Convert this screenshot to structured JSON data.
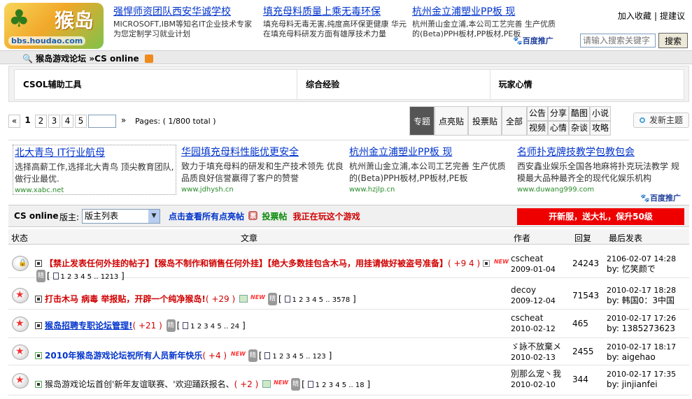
{
  "header": {
    "logo_text": "猴岛",
    "logo_url": "bbs.houdao.com",
    "ads": [
      {
        "title": "强悍师资团队西安华诚学校",
        "desc": "MICROSOFT,IBM等知名IT企业技术专家 为您定制学习就业计划"
      },
      {
        "title": "填充母料质量上乘无毒环保",
        "desc": "填充母料无毒无害,纯度高环保更健康 华元在填充母料研发方面有雄厚技术力量"
      },
      {
        "title": "杭州金立浦塑业PP板 现",
        "desc": "杭州萧山金立浦,本公司工艺完善 生产优质的(Beta)PPH板材,PP板材,PE板"
      }
    ],
    "links": [
      "加入收藏",
      "提建议"
    ],
    "baidu_label": "百度推广",
    "search_placeholder": "请输入搜索关键字",
    "search_button": "搜索"
  },
  "breadcrumb": {
    "forum": "猴岛游戏论坛",
    "sep": "»",
    "current": "CS online"
  },
  "subforums": [
    "CSOL辅助工具",
    "综合经验",
    "玩家心情"
  ],
  "pager": {
    "first": "«",
    "pages": [
      "1",
      "2",
      "3",
      "4",
      "5"
    ],
    "current": "1",
    "last": "»",
    "total": "Pages: ( 1/800 total )"
  },
  "type_filter": {
    "big": [
      "专题",
      "点亮贴",
      "投票贴",
      "全部"
    ],
    "selected": "专题",
    "small": [
      "公告",
      "分享",
      "酷图",
      "小说",
      "视频",
      "心情",
      "杂谈",
      "攻略"
    ]
  },
  "new_thread": "发新主题",
  "ads2": [
    {
      "title": "北大青鸟 IT行业航母",
      "desc": "选择高薪工作,选择北大青鸟 顶尖教育团队,做行业最优.",
      "url": "www.xabc.net"
    },
    {
      "title": "华园填充母料性能优更安全",
      "desc": "致力于填充母料的研发和生产技术领先 优良品质良好信誉赢得了客户的赞誉",
      "url": "www.jdhysh.cn"
    },
    {
      "title": "杭州金立浦塑业PP板 现",
      "desc": "杭州萧山金立浦,本公司工艺完善 生产优质的(Beta)PPH板材,PP板材,PE板",
      "url": "www.hzjlp.cn"
    },
    {
      "title": "名师扑克牌技教学包教包会",
      "desc": "西安鑫业娱乐全国各地麻将扑克玩法教学 规模最大品种最齐全的现代化娱乐机构",
      "url": "www.duwang999.com"
    }
  ],
  "forum_bar": {
    "name": "CS online",
    "moderator_label": "版主:",
    "moderator_select": "版主列表",
    "link1": "点击查看所有点亮帖",
    "link2": "投票帖",
    "link3": "我正在玩这个游戏",
    "promo": "开新服，送大礼，保升50级"
  },
  "table": {
    "headers": {
      "status": "状态",
      "topic": "文章",
      "author": "作者",
      "replies": "回复",
      "last": "最后发表"
    },
    "rows": [
      {
        "title": "【禁止发表任何外挂的帖子】【猴岛不制作和销售任何外挂】【绝大多数挂包含木马，用挂请做好被盗号准备】",
        "plus": "( +9 4 )",
        "pages": "1 2 3 4 5 .. 1213",
        "author": "cscheat",
        "author_date": "2009-01-04",
        "replies": "24243",
        "last_date": "2106-02-07 14:28",
        "last_by": "by: 忆笑颜で"
      },
      {
        "title": "打击木马 病毒 举报贴，开辟一个纯净猴岛!",
        "plus": "( +29 )",
        "pages": "1 2 3 4 5 .. 3578",
        "author": "decoy",
        "author_date": "2009-12-04",
        "replies": "71543",
        "last_date": "2010-02-17 18:28",
        "last_by": "by: 韩国0：3中国"
      },
      {
        "title": "猴岛招聘专职论坛管理!",
        "plus": "( +21 )",
        "pages": "1 2 3 4 5 .. 24",
        "author": "cscheat",
        "author_date": "2010-02-12",
        "replies": "465",
        "last_date": "2010-02-17 17:26",
        "last_by": "by: 1385273623"
      },
      {
        "title": "2010年猴岛游戏论坛祝所有人员新年快乐",
        "plus": "( +4 )",
        "pages": "1 2 3 4 5 .. 123",
        "author": "ゞ詠不放棄メ",
        "author_date": "2010-02-13",
        "replies": "2455",
        "last_date": "2010-02-17 18:17",
        "last_by": "by: aigehao"
      },
      {
        "title": "猴岛游戏论坛首创'新年友谊联赛、'欢迎踊跃报名、",
        "plus": "( +2 )",
        "pages": "1 2 3 4 5 .. 18",
        "author": "別那么宠丶我",
        "author_date": "2010-02-10",
        "replies": "344",
        "last_date": "2010-02-17 17:35",
        "last_by": "by: jinjianfei"
      }
    ]
  }
}
